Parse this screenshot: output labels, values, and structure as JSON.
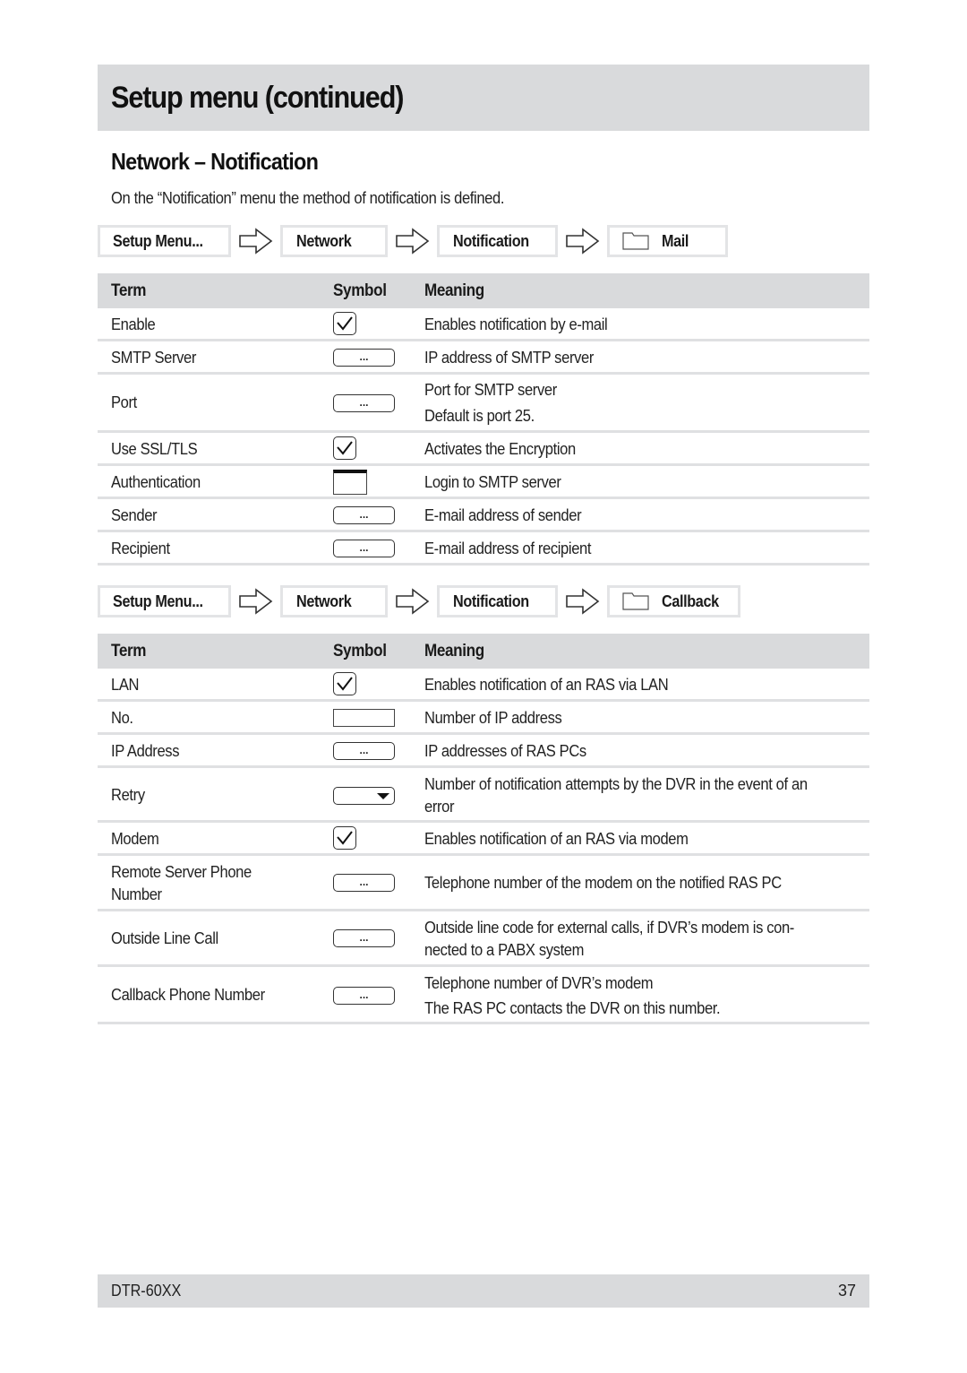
{
  "page": {
    "title": "Setup menu (continued)",
    "section_title": "Network – Notification",
    "intro": "On the “Notification” menu the method of notification is defined."
  },
  "mail": {
    "path": [
      {
        "label": "Setup Menu...",
        "icon": null
      },
      {
        "label": "Network",
        "icon": null
      },
      {
        "label": "Notification",
        "icon": null
      },
      {
        "label": "Mail",
        "icon": "folder-icon"
      }
    ],
    "headers": {
      "term": "Term",
      "symbol": "Symbol",
      "meaning": "Meaning"
    },
    "rows": [
      {
        "term": "Enable",
        "symbol": "checkbox",
        "meaning": "Enables notification by e-mail"
      },
      {
        "term": "SMTP Server",
        "symbol": "button",
        "symbol_label": "...",
        "meaning": "IP address of SMTP server"
      },
      {
        "term": "Port",
        "symbol": "button",
        "symbol_label": "...",
        "meaning": "Port for SMTP server",
        "meaning2": "Default is port 25."
      },
      {
        "term": "Use SSL/TLS",
        "symbol": "checkbox",
        "meaning": "Activates the Encryption"
      },
      {
        "term": "Authentication",
        "symbol": "window",
        "meaning": "Login to SMTP server"
      },
      {
        "term": "Sender",
        "symbol": "button",
        "symbol_label": "...",
        "meaning": "E-mail address of sender"
      },
      {
        "term": "Recipient",
        "symbol": "button",
        "symbol_label": "...",
        "meaning": "E-mail address of recipient"
      }
    ]
  },
  "callback": {
    "path": [
      {
        "label": "Setup Menu...",
        "icon": null
      },
      {
        "label": "Network",
        "icon": null
      },
      {
        "label": "Notification",
        "icon": null
      },
      {
        "label": "Callback",
        "icon": "folder-icon"
      }
    ],
    "headers": {
      "term": "Term",
      "symbol": "Symbol",
      "meaning": "Meaning"
    },
    "rows": [
      {
        "term": "LAN",
        "symbol": "checkbox",
        "meaning": "Enables notification of an RAS via LAN"
      },
      {
        "term": "No.",
        "symbol": "field",
        "meaning": "Number of IP address"
      },
      {
        "term": "IP Address",
        "symbol": "button",
        "symbol_label": "...",
        "meaning": "IP addresses of RAS PCs"
      },
      {
        "term": "Retry",
        "symbol": "dropdown",
        "meaning": "Number of notification attempts by the DVR in the event of an",
        "meaning2": "error"
      },
      {
        "term": "Modem",
        "symbol": "checkbox",
        "meaning": "Enables notification of an RAS via modem"
      },
      {
        "term": "Remote Server Phone",
        "term2": "Number",
        "symbol": "button",
        "symbol_label": "...",
        "meaning": "Telephone number of the modem on the notified RAS PC"
      },
      {
        "term": "Outside Line Call",
        "symbol": "button",
        "symbol_label": "...",
        "meaning": "Outside line code for external calls, if DVR’s modem is con-",
        "meaning2": "nected to a PABX system"
      },
      {
        "term": "Callback Phone Number",
        "symbol": "button",
        "symbol_label": "...",
        "meaning": "Telephone number of DVR’s modem",
        "meaning2": "The RAS PC contacts the DVR on this number."
      }
    ]
  },
  "footer": {
    "model": "DTR-60XX",
    "page_number": "37"
  }
}
